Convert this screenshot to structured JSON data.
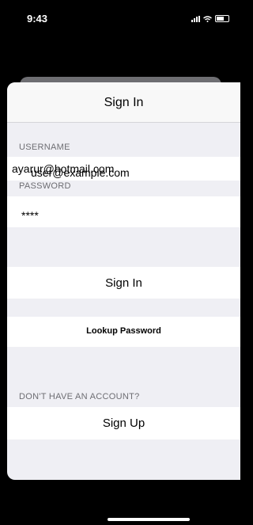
{
  "status_bar": {
    "time": "9:43"
  },
  "sheet": {
    "title": "Sign In",
    "username_label": "USERNAME",
    "username_value": "ayarur@hotmail.com",
    "username_overlay": "user@example.com",
    "password_label": "PASSWORD",
    "password_value": "****",
    "sign_in_label": "Sign In",
    "lookup_password_label": "Lookup Password",
    "no_account_label": "DON'T HAVE AN ACCOUNT?",
    "sign_up_label": "Sign Up"
  }
}
